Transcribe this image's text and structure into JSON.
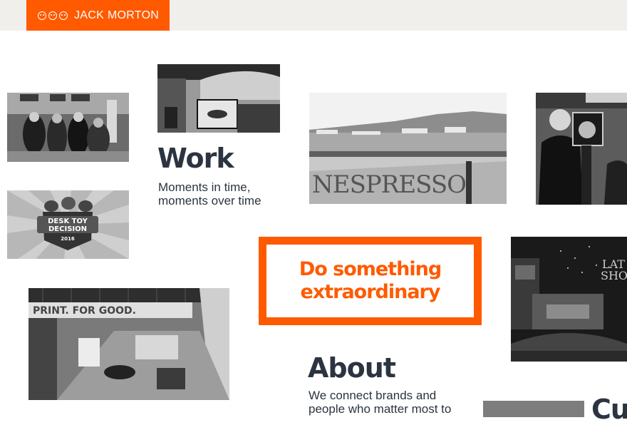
{
  "header": {
    "brand": "JACK MORTON"
  },
  "work": {
    "title": "Work",
    "line1": "Moments in time,",
    "line2": "moments over time"
  },
  "cta": {
    "line1": "Do something",
    "line2": "extraordinary"
  },
  "about": {
    "title": "About",
    "line1": "We connect brands and",
    "line2": "people who matter most to"
  },
  "partial_heading": "Cu",
  "images": {
    "desk_toy_badge": {
      "line1": "DESK TOY",
      "line2": "DECISION",
      "year": "2016"
    },
    "nespresso": "NESPRESSO",
    "print_for_good": "PRINT. FOR GOOD.",
    "late_show": {
      "line1": "LAT",
      "line2": "SHO"
    }
  },
  "colors": {
    "accent": "#ff5a00",
    "text": "#2b3440",
    "topbar": "#f1efec"
  }
}
